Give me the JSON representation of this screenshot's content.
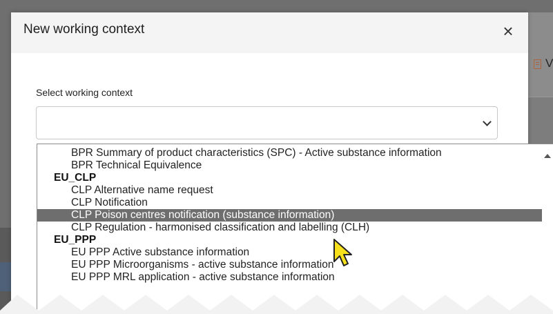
{
  "modal": {
    "title": "New working context",
    "close_label": "×"
  },
  "form": {
    "label": "Select working context",
    "selected_value": ""
  },
  "background": {
    "partial_letter": "V"
  },
  "dropdown": {
    "rows": [
      {
        "type": "option",
        "label": "BPR Summary of product characteristics (SPC) - Active substance information"
      },
      {
        "type": "option",
        "label": "BPR Technical Equivalence"
      },
      {
        "type": "group",
        "label": "EU_CLP"
      },
      {
        "type": "option",
        "label": "CLP Alternative name request"
      },
      {
        "type": "option",
        "label": "CLP Notification"
      },
      {
        "type": "option",
        "label": "CLP Poison centres notification (substance information)",
        "highlighted": true
      },
      {
        "type": "option",
        "label": "CLP Regulation - harmonised classification and labelling (CLH)"
      },
      {
        "type": "group",
        "label": "EU_PPP"
      },
      {
        "type": "option",
        "label": "EU PPP Active substance information"
      },
      {
        "type": "option",
        "label": "EU PPP Microorganisms - active substance information"
      },
      {
        "type": "option",
        "label": "EU PPP MRL application - active substance information"
      }
    ]
  },
  "colors": {
    "highlight_bg": "#6e6e6e",
    "cursor_fill": "#f7e01c"
  },
  "icons": {
    "close": "close-icon",
    "chevron": "chevron-down-icon",
    "scroll": "scroll-up-arrow-icon",
    "cursor": "mouse-pointer-icon",
    "doc": "document-icon"
  }
}
